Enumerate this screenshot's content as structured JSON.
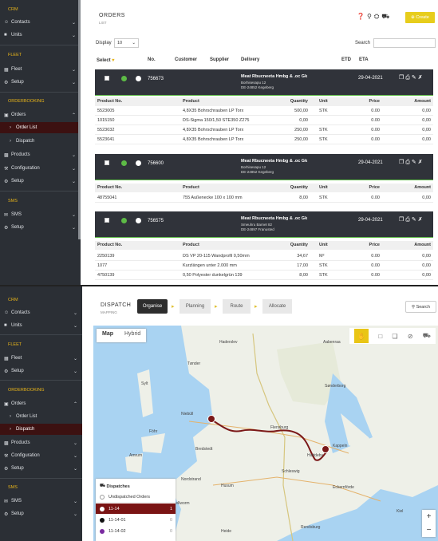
{
  "sidebar": {
    "sections": [
      {
        "label": "CRM",
        "items": [
          {
            "icon": "contacts-icon",
            "label": "Contacts"
          },
          {
            "icon": "units-icon",
            "label": "Units"
          }
        ]
      },
      {
        "label": "FLEET",
        "items": [
          {
            "icon": "truck-icon",
            "label": "Fleet"
          },
          {
            "icon": "gear-icon",
            "label": "Setup"
          }
        ]
      },
      {
        "label": "ORDERBOOKING",
        "items": [
          {
            "icon": "document-icon",
            "label": "Orders"
          },
          {
            "label": "Order List"
          },
          {
            "label": "Dispatch"
          },
          {
            "icon": "box-icon",
            "label": "Products"
          },
          {
            "icon": "wrench-icon",
            "label": "Configuration"
          },
          {
            "icon": "gear-icon",
            "label": "Setup"
          }
        ]
      },
      {
        "label": "SMS",
        "items": [
          {
            "icon": "sms-icon",
            "label": "SMS"
          },
          {
            "icon": "gear-icon",
            "label": "Setup"
          }
        ]
      }
    ]
  },
  "orders_page": {
    "title": "ORDERS",
    "subtitle": "LIST",
    "create_label": "Create",
    "display_label": "Display",
    "display_value": "10",
    "search_label": "Search",
    "columns": [
      "Select",
      "No.",
      "Customer",
      "Supplier",
      "Delivery",
      "ETD",
      "ETA"
    ],
    "product_columns": [
      "Product No.",
      "Product",
      "Quantity",
      "Unit",
      "Price",
      "Amount"
    ],
    "orders": [
      {
        "number": "756673",
        "name": "Meat Rbucneeta Hmbg & .oc Gk",
        "address1": "Borhisesapu 12",
        "address2": "DE-24852 Kegeberg",
        "date": "29-04-2021",
        "products": [
          [
            "5523005",
            "4,8X35 Bohrschrauben LP Torx",
            "500,00",
            "STK",
            "0.00",
            "0,00"
          ],
          [
            "1015150",
            "DS-Sigma 150/1,50 STE350 Z275",
            "0,00",
            "",
            "0.00",
            "0,00"
          ],
          [
            "5523032",
            "4,8X35 Bohrschrauben LP Torx",
            "250,00",
            "STK",
            "0.00",
            "0,00"
          ],
          [
            "5523041",
            "4,8X35 Bohrschrauben LP Torx",
            "250,00",
            "STK",
            "0.00",
            "0,00"
          ]
        ]
      },
      {
        "number": "756600",
        "name": "Meat Rbucneeta Hmbg & .oc Gk",
        "address1": "Borhisesapu 12",
        "address2": "DE-24852 Kegeberg",
        "date": "29-04-2021",
        "products": [
          [
            "48755041",
            "755 Außenecke 100 x 100 mm",
            "8,00",
            "STK",
            "0.00",
            "0,00"
          ]
        ]
      },
      {
        "number": "756575",
        "name": "Meat Rbucneeta Hmbg & .oc Gk",
        "address1": "Smeuhru Barnet 82",
        "address2": "DE-24897 Franusted",
        "date": "29-04-2021",
        "products": [
          [
            "2250139",
            "DS VP 20-115 Wandprofil 0,50mm",
            "34,67",
            "M²",
            "0.00",
            "0,00"
          ],
          [
            "1077",
            "Kurzlängen unter 2.000 mm",
            "17,00",
            "STK",
            "0.00",
            "0,00"
          ],
          [
            "4750139",
            "0,50 Polyester dunkelgrün 139",
            "8,00",
            "STK",
            "0.00",
            "0,00"
          ]
        ]
      }
    ]
  },
  "dispatch_page": {
    "title": "DISPATCH",
    "subtitle": "MAPPING",
    "steps": [
      "Organise",
      "Planning",
      "Route",
      "Allocate"
    ],
    "search_label": "Search",
    "map_tabs": [
      "Map",
      "Hybrid"
    ],
    "places": [
      "Flensburg",
      "Kappeln",
      "Schleswig",
      "Husum",
      "Sønderborg",
      "Aabenraa",
      "Haderslev",
      "Rendsburg",
      "Eckernförde",
      "Tønder",
      "Niebüll",
      "Sylt",
      "Föhr",
      "Amrum",
      "Bredstedt",
      "Kiel",
      "Heide",
      "Nordstrand",
      "Pellworm",
      "Haddeby"
    ],
    "dispatches_title": "Dispatches",
    "dispatches": [
      {
        "label": "Undispatched Orders",
        "count": "",
        "color": "#ffffff"
      },
      {
        "label": "11-14",
        "count": "1",
        "color": "#a01c1c"
      },
      {
        "label": "11-14-01",
        "count": "0",
        "color": "#111111"
      },
      {
        "label": "11-14-02",
        "count": "0",
        "color": "#7a2aa0"
      }
    ]
  }
}
